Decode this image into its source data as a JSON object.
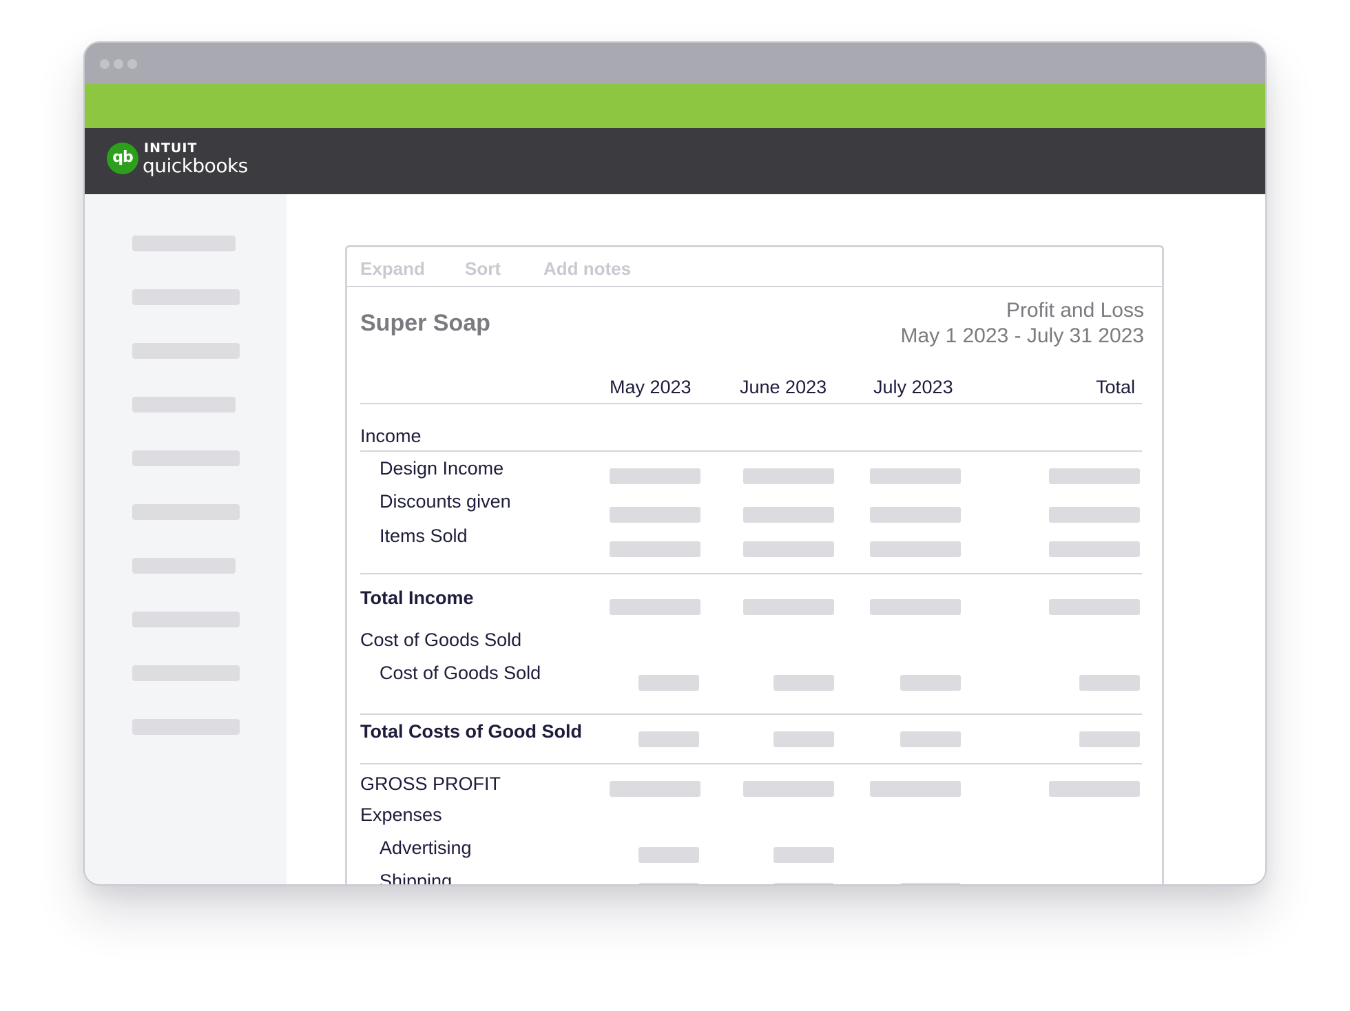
{
  "app": {
    "brand_top": "INTUIT",
    "brand_name": "quickbooks",
    "logo_mark": "qb",
    "colors": {
      "titlebar": "#a9a9b1",
      "accent_bar": "#8dc641",
      "header": "#3b3b40",
      "logo_green": "#2ca01c",
      "text_dark": "#1d1d3b"
    }
  },
  "toolbar": {
    "expand_label": "Expand",
    "sort_label": "Sort",
    "notes_label": "Add notes"
  },
  "report": {
    "company": "Super Soap",
    "type": "Profit and Loss",
    "range": "May 1 2023 - July 31 2023",
    "columns": [
      "May 2023",
      "June 2023",
      "July 2023",
      "Total"
    ],
    "rows": [
      {
        "label": "Income"
      },
      {
        "label": "Design Income"
      },
      {
        "label": "Discounts given"
      },
      {
        "label": "Items Sold"
      },
      {
        "label": "Total Income"
      },
      {
        "label": "Cost of Goods Sold"
      },
      {
        "label": "Cost of Goods Sold"
      },
      {
        "label": "Total Costs of Good Sold"
      },
      {
        "label": "GROSS PROFIT"
      },
      {
        "label": "Expenses"
      },
      {
        "label": "Advertising"
      },
      {
        "label": "Shipping"
      }
    ]
  }
}
